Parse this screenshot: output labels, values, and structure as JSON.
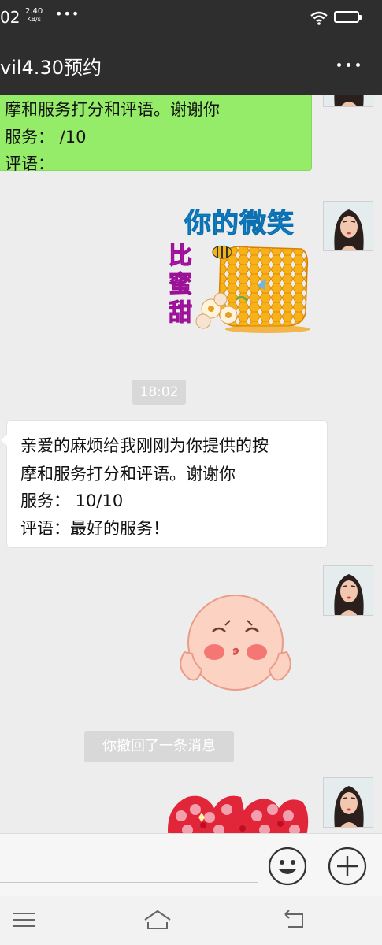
{
  "status_bar": {
    "time": "02",
    "net_speed_value": "2.40",
    "net_speed_unit": "KB/s",
    "notification_dots": "•••",
    "battery_level": "89",
    "battery_fraction": 0.89
  },
  "header": {
    "title": "vil4.30预约"
  },
  "messages": {
    "sent_1": {
      "line_1": "摩和服务打分和评语。谢谢你",
      "line_2": "服务：  /10",
      "line_3": "评语："
    },
    "sticker_1": {
      "caption_top": "你的微笑",
      "caption_side": "比蜜甜"
    },
    "time_divider": "18:02",
    "received_1": {
      "line_1": "亲爱的麻烦给我刚刚为你提供的按",
      "line_2": "摩和服务打分和评语。谢谢你",
      "line_3": "服务：  10/10",
      "line_4": "评语：最好的服务！"
    },
    "recall_notice": "你撤回了一条消息"
  },
  "icons": {
    "wifi": "wifi-icon",
    "battery": "battery-icon",
    "more": "more-dots-icon",
    "emoji": "emoji-face-icon",
    "plus": "plus-circle-icon",
    "menu": "menu-icon",
    "home": "home-icon",
    "back": "back-icon"
  },
  "colors": {
    "top_bar": "#2e2e2e",
    "chat_bg": "#ededed",
    "sent_bubble": "#95ec69",
    "received_bubble": "#ffffff",
    "system_chip": "#d8d8d8"
  }
}
